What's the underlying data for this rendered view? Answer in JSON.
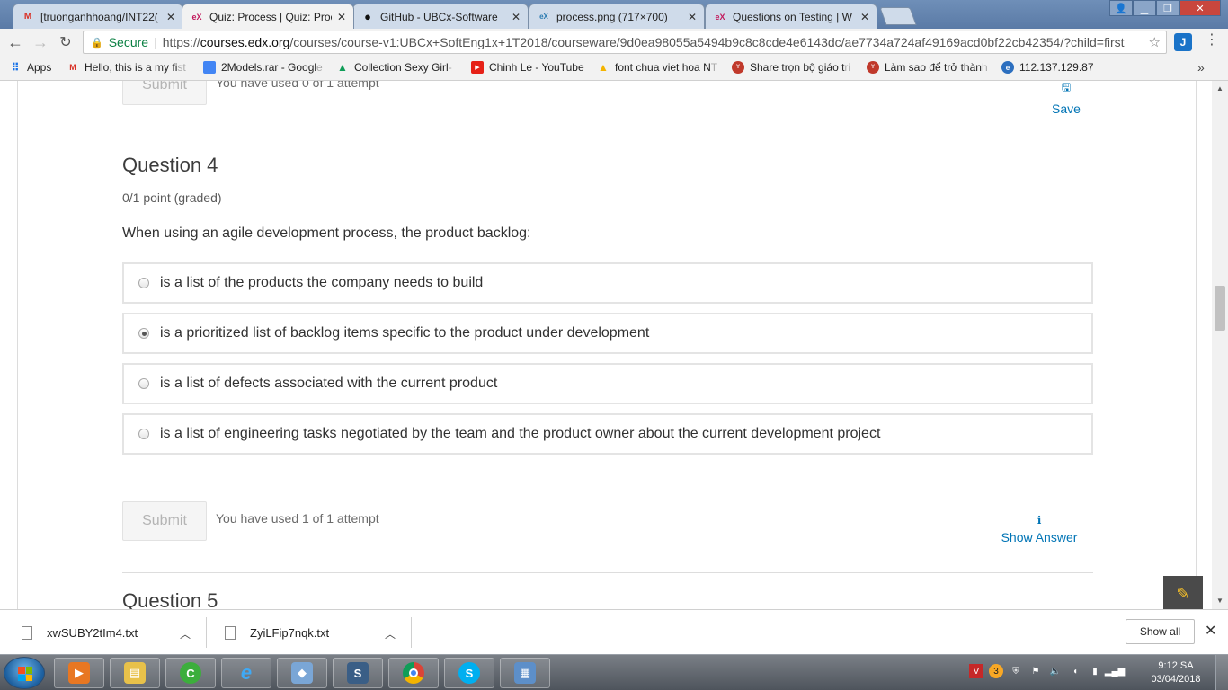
{
  "browser": {
    "tabs": [
      {
        "favicon": "gmail-icon",
        "title": "[truonganhhoang/INT22(",
        "active": false
      },
      {
        "favicon": "edx-icon",
        "title": "Quiz: Process | Quiz: Proc",
        "active": true
      },
      {
        "favicon": "github-icon",
        "title": "GitHub - UBCx-Software",
        "active": false
      },
      {
        "favicon": "openedx-icon",
        "title": "process.png (717×700)",
        "active": false
      },
      {
        "favicon": "edx-icon",
        "title": "Questions on Testing | W",
        "active": false
      }
    ],
    "secure_label": "Secure",
    "url_scheme": "https://",
    "url_host": "courses.edx.org",
    "url_path": "/courses/course-v1:UBCx+SoftEng1x+1T2018/courseware/9d0ea98055a5494b9c8c8cde4e6143dc/ae7734a724af49169acd0bf22cb42354/?child=first",
    "extension_label": "J"
  },
  "bookmarks": [
    {
      "icon": "apps-icon",
      "label": "Apps",
      "faded": ""
    },
    {
      "icon": "gmail-icon",
      "label": "Hello, this is a my fi",
      "faded": "st"
    },
    {
      "icon": "doc-icon",
      "label": "2Models.rar - Googl",
      "faded": "e"
    },
    {
      "icon": "drive-icon",
      "label": "Collection Sexy Girl",
      "faded": " -"
    },
    {
      "icon": "youtube-icon",
      "label": "Chinh Le - YouTube",
      "faded": ""
    },
    {
      "icon": "drive-icon",
      "label": "font chua viet hoa N",
      "faded": "T"
    },
    {
      "icon": "ytb-icon",
      "label": "Share trọn bộ giáo t",
      "faded": "ri"
    },
    {
      "icon": "ytb-icon",
      "label": "Làm sao để trở thàn",
      "faded": "h"
    },
    {
      "icon": "globe-icon",
      "label": "112.137.129.87",
      "faded": ""
    }
  ],
  "content": {
    "prev_submit_label": "Submit",
    "prev_attempt_text": "You have used 0 of 1 attempt",
    "save_label": "Save",
    "question_title": "Question 4",
    "points": "0/1 point (graded)",
    "prompt": "When using an agile development process, the product backlog:",
    "choices": [
      {
        "text": "is a list of the products the company needs to build",
        "selected": false
      },
      {
        "text": "is a prioritized list of backlog items specific to the product under development",
        "selected": true
      },
      {
        "text": "is a list of defects associated with the current product",
        "selected": false
      },
      {
        "text": "is a list of engineering tasks negotiated by the team and the product owner about the current development project",
        "selected": false
      }
    ],
    "submit_label": "Submit",
    "attempt_text": "You have used 1 of 1 attempt",
    "show_answer_label": "Show Answer",
    "next_question_title": "Question 5"
  },
  "downloads": {
    "files": [
      "xwSUBY2tIm4.txt",
      "ZyiLFip7nqk.txt"
    ],
    "show_all_label": "Show all"
  },
  "taskbar": {
    "time": "9:12 SA",
    "date": "03/04/2018"
  }
}
